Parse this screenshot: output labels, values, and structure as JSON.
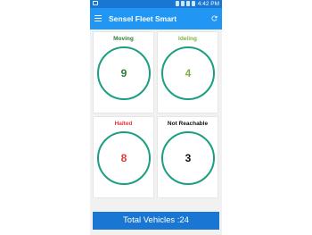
{
  "status_bar": {
    "time": "4:42 PM",
    "battery": "11%"
  },
  "app_bar": {
    "title": "Sensel Fleet Smart",
    "menu_icon": "hamburger-menu-icon",
    "refresh_icon": "refresh-icon"
  },
  "cards": [
    {
      "label": "Moving",
      "count": "9",
      "label_color": "#2e7d32",
      "count_color": "#2e7d32"
    },
    {
      "label": "Ideling",
      "count": "4",
      "label_color": "#7cb342",
      "count_color": "#7cb342"
    },
    {
      "label": "Halted",
      "count": "8",
      "label_color": "#e53935",
      "count_color": "#e53935"
    },
    {
      "label": "Not Reachable",
      "count": "3",
      "label_color": "#111111",
      "count_color": "#111111"
    }
  ],
  "ring_color": "#1b9e82",
  "total": {
    "label": "Total Vehicles :24"
  }
}
